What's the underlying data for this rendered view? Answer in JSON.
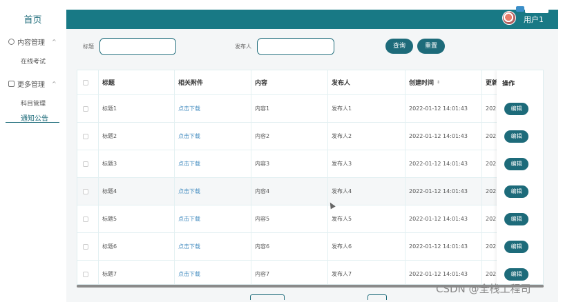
{
  "sidebar": {
    "home": "首页",
    "groups": [
      {
        "label": "内容管理",
        "chevron": "^",
        "items": [
          "在线考试"
        ]
      },
      {
        "label": "更多管理",
        "chevron": "^",
        "items": [
          "科目管理",
          "通知公告"
        ]
      }
    ]
  },
  "header": {
    "user_name": "用户1",
    "user_tag": "",
    "user_badge": ""
  },
  "search": {
    "title_label": "标题",
    "publisher_label": "发布人",
    "title_value": "",
    "publisher_value": "",
    "query_button": "查询",
    "reset_button": "重置"
  },
  "table": {
    "columns": [
      "标题",
      "相关附件",
      "内容",
      "发布人",
      "创建时间",
      "更新",
      "操作"
    ],
    "sort_icon": "⇕",
    "rows": [
      {
        "title": "标题1",
        "attachment": "点击下载",
        "content": "内容1",
        "publisher": "发布人1",
        "created": "2022-01-12 14:01:43",
        "updated": "202",
        "action": "编辑"
      },
      {
        "title": "标题2",
        "attachment": "点击下载",
        "content": "内容2",
        "publisher": "发布人2",
        "created": "2022-01-12 14:01:43",
        "updated": "202",
        "action": "编辑"
      },
      {
        "title": "标题3",
        "attachment": "点击下载",
        "content": "内容3",
        "publisher": "发布人3",
        "created": "2022-01-12 14:01:43",
        "updated": "202",
        "action": "编辑"
      },
      {
        "title": "标题4",
        "attachment": "点击下载",
        "content": "内容4",
        "publisher": "发布人4",
        "created": "2022-01-12 14:01:43",
        "updated": "202",
        "action": "编辑"
      },
      {
        "title": "标题5",
        "attachment": "点击下载",
        "content": "内容5",
        "publisher": "发布人5",
        "created": "2022-01-12 14:01:43",
        "updated": "202",
        "action": "编辑"
      },
      {
        "title": "标题6",
        "attachment": "点击下载",
        "content": "内容6",
        "publisher": "发布人6",
        "created": "2022-01-12 14:01:43",
        "updated": "202",
        "action": "编辑"
      },
      {
        "title": "标题7",
        "attachment": "点击下载",
        "content": "内容7",
        "publisher": "发布人7",
        "created": "2022-01-12 14:01:43",
        "updated": "202",
        "action": "编辑"
      }
    ]
  },
  "watermark": "CSDN @全栈工程司",
  "colors": {
    "primary": "#187985",
    "accent": "#1d6b7a",
    "link": "#4a90c2"
  }
}
